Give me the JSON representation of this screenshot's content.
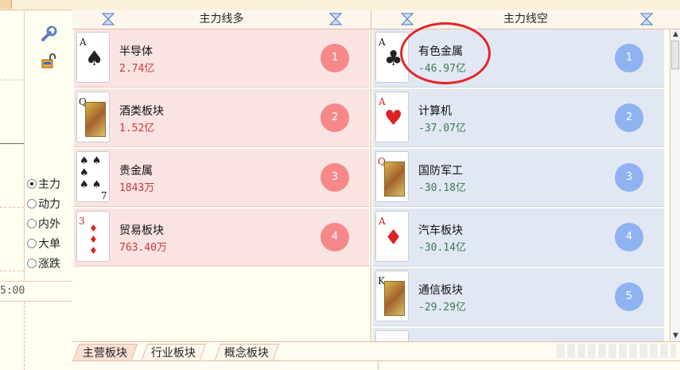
{
  "time_label": "5:00",
  "radio_options": [
    {
      "label": "主力",
      "selected": true
    },
    {
      "label": "动力",
      "selected": false
    },
    {
      "label": "内外",
      "selected": false
    },
    {
      "label": "大单",
      "selected": false
    },
    {
      "label": "涨跌",
      "selected": false
    }
  ],
  "left_panel": {
    "title": "主力线多",
    "rows": [
      {
        "rank": "A",
        "name": "半导体",
        "value": "2.74亿",
        "badge": "1"
      },
      {
        "rank": "Q",
        "name": "酒类板块",
        "value": "1.52亿",
        "badge": "2"
      },
      {
        "rank": "7",
        "name": "贵金属",
        "value": "1843万",
        "badge": "3"
      },
      {
        "rank": "3",
        "name": "贸易板块",
        "value": "763.40万",
        "badge": "4"
      }
    ]
  },
  "right_panel": {
    "title": "主力线空",
    "rows": [
      {
        "rank": "A",
        "name": "有色金属",
        "value": "-46.97亿",
        "badge": "1"
      },
      {
        "rank": "A",
        "name": "计算机",
        "value": "-37.07亿",
        "badge": "2"
      },
      {
        "rank": "Q",
        "name": "国防军工",
        "value": "-30.18亿",
        "badge": "3"
      },
      {
        "rank": "A",
        "name": "汽车板块",
        "value": "-30.14亿",
        "badge": "4"
      },
      {
        "rank": "K",
        "name": "通信板块",
        "value": "-29.29亿",
        "badge": "5"
      }
    ]
  },
  "tabs": [
    "主营板块",
    "行业板块",
    "概念板块"
  ],
  "colors": {
    "positive": "#c73a3a",
    "negative": "#3a7a50",
    "badge_left": "#f78888",
    "badge_right": "#8fb3f0",
    "annotation": "#e3262a"
  }
}
